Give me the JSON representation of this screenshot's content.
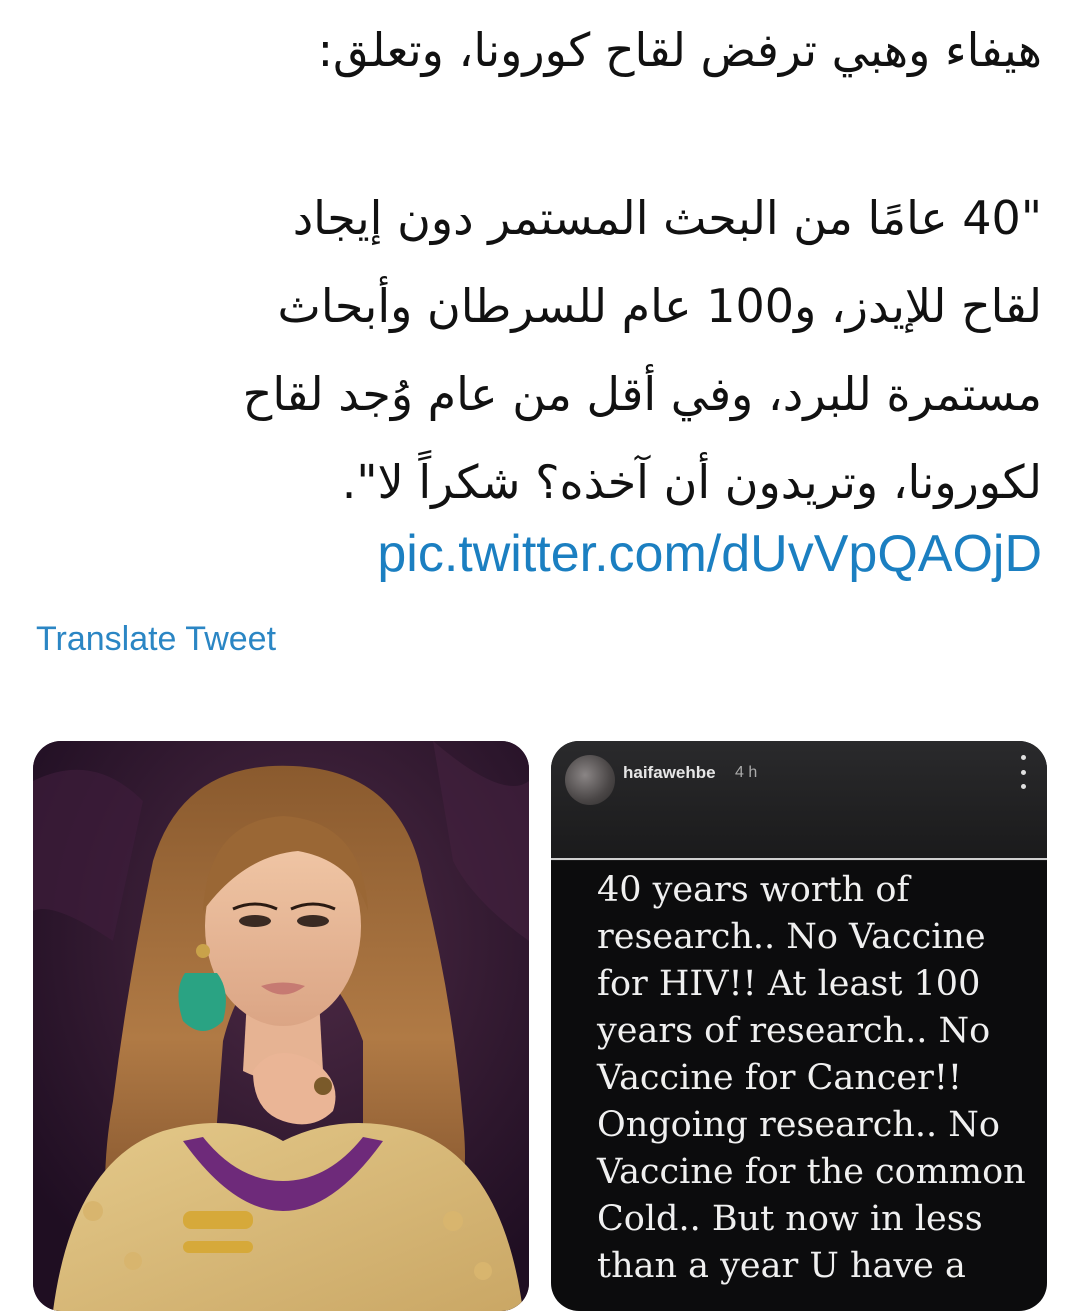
{
  "tweet": {
    "headline": "هيفاء وهبي ترفض لقاح كورونا، وتعلق:",
    "quote_lines": [
      "\"40 عامًا من البحث المستمر دون إيجاد",
      "لقاح للإيدز، و100 عام للسرطان وأبحاث",
      "مستمرة للبرد، وفي أقل من عام وُجد لقاح",
      "لكورونا، وتريدون أن آخذه؟ شكراً لا\"."
    ],
    "link": "pic.twitter.com/dUvVpQAOjD",
    "translate_label": "Translate Tweet"
  },
  "story": {
    "username": "haifawehbe",
    "time": "4 h",
    "lines": [
      "40 years worth of",
      "research.. No Vaccine",
      "for HIV!! At least 100",
      "years of research.. No",
      "Vaccine for Cancer!!",
      "Ongoing research.. No",
      "Vaccine for the common",
      "Cold.. But now in less",
      "than a year U have a"
    ]
  },
  "colors": {
    "link": "#1b7fc1",
    "translate": "#2b86c4",
    "story_bg": "#0c0c0d",
    "photo_bg": "#2b1230"
  },
  "icons": {
    "story_menu": "more-vertical-icon",
    "avatar": "avatar"
  }
}
